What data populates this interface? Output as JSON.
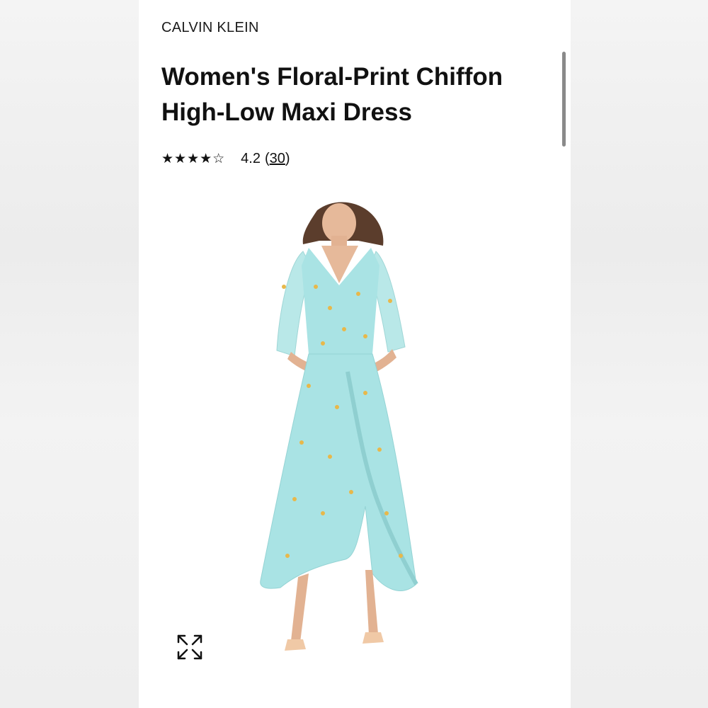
{
  "product": {
    "brand": "CALVIN KLEIN",
    "title": "Women's Floral-Print Chiffon High-Low Maxi Dress",
    "stars": "★★★★☆",
    "rating": "4.2",
    "review_count": "30",
    "paren_open": "(",
    "paren_close": ")"
  },
  "image": {
    "alt": "Model wearing light aqua floral-print chiffon high-low maxi dress",
    "dress_color": "#a9e3e4",
    "flower_color": "#e8b84a"
  },
  "icons": {
    "expand": "expand-arrows-icon"
  }
}
